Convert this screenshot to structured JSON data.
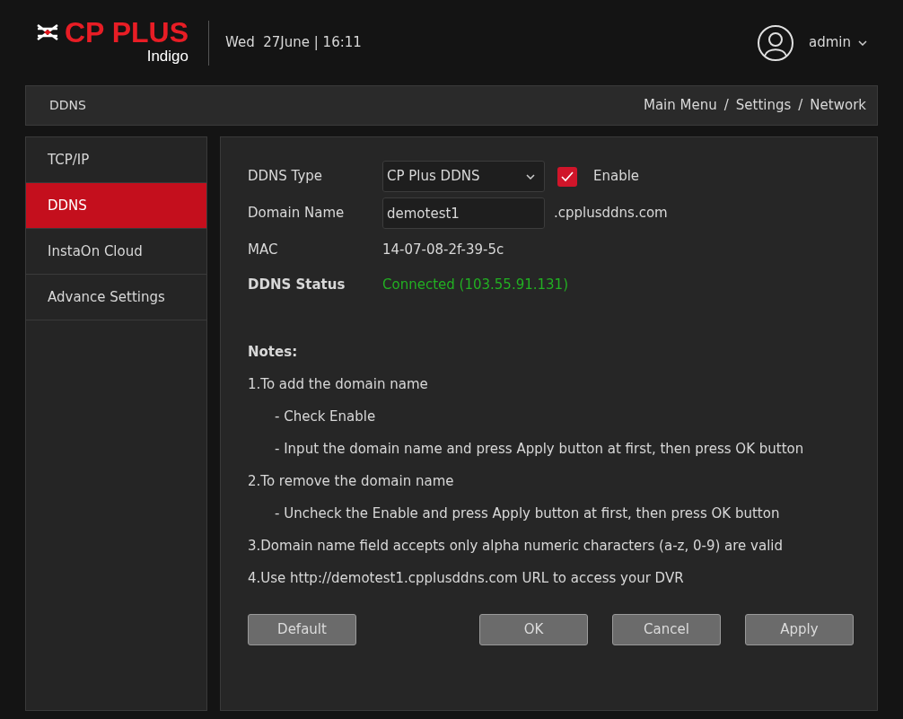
{
  "header": {
    "logo": {
      "brand": "CP PLUS",
      "subbrand": "Indigo"
    },
    "datetime": "Wed  27June | 16:11",
    "user": "admin"
  },
  "breadcrumb_bar": {
    "title": "DDNS",
    "path": [
      "Main Menu",
      "Settings",
      "Network"
    ],
    "separator": "/"
  },
  "sidebar": {
    "items": [
      {
        "label": "TCP/IP",
        "selected": false
      },
      {
        "label": "DDNS",
        "selected": true
      },
      {
        "label": "InstaOn Cloud",
        "selected": false
      },
      {
        "label": "Advance Settings",
        "selected": false
      }
    ]
  },
  "form": {
    "ddns_type": {
      "label": "DDNS Type",
      "value": "CP Plus DDNS"
    },
    "enable": {
      "label": "Enable",
      "checked": true
    },
    "domain_name": {
      "label": "Domain Name",
      "value": "demotest1",
      "suffix": ".cpplusddns.com"
    },
    "mac": {
      "label": "MAC",
      "value": "14-07-08-2f-39-5c"
    },
    "status": {
      "label": "DDNS Status",
      "value": "Connected (103.55.91.131)",
      "color": "#22b022"
    }
  },
  "notes": {
    "title": "Notes:",
    "items": [
      {
        "text": "1.To add the domain name",
        "children": [
          {
            "text": "- Check Enable"
          },
          {
            "text": "- Input the domain name and press Apply button at first, then press OK button"
          }
        ]
      },
      {
        "text": "2.To remove the domain name",
        "children": [
          {
            "text": "- Uncheck the Enable and press Apply button at first, then press OK button"
          }
        ]
      },
      {
        "text": "3.Domain name field accepts only alpha numeric characters (a-z, 0-9) are valid"
      },
      {
        "text": "4.Use http://demotest1.cpplusddns.com URL to access your DVR"
      }
    ]
  },
  "buttons": {
    "left": [
      "Default"
    ],
    "right": [
      "OK",
      "Cancel",
      "Apply"
    ]
  }
}
